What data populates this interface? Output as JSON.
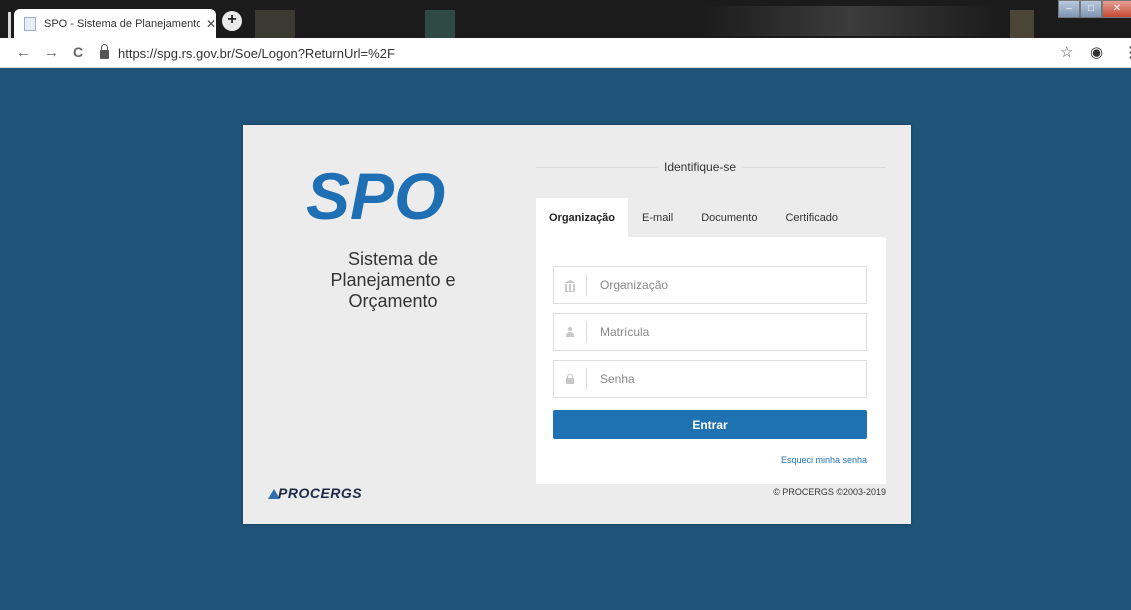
{
  "browser": {
    "tab_title": "SPO - Sistema de Planejamento e",
    "tab_close": "✕",
    "new_tab": "+",
    "back": "←",
    "forward": "→",
    "reload": "C",
    "url": "https://spg.rs.gov.br/Soe/Logon?ReturnUrl=%2F",
    "star": "☆",
    "profile": "◉",
    "menu": "⋮",
    "window_minimize": "–",
    "window_maximize": "□",
    "window_close": "✕"
  },
  "brand": {
    "logo_text": "SPO",
    "logo_color": "#1f6fb5",
    "system_name_lines": [
      "Sistema de",
      "Planejamento e",
      "Orçamento"
    ],
    "company": "PROCERGS",
    "copyright": "© PROCERGS ©2003-2019"
  },
  "login": {
    "heading": "Identifique-se",
    "tabs": [
      {
        "label": "Organização",
        "active": true
      },
      {
        "label": "E-mail",
        "active": false
      },
      {
        "label": "Documento",
        "active": false
      },
      {
        "label": "Certificado",
        "active": false
      }
    ],
    "fields": [
      {
        "name": "organizacao",
        "icon": "bank-icon",
        "value": "",
        "placeholder": "Organização"
      },
      {
        "name": "matricula",
        "icon": "user-icon",
        "value": "",
        "placeholder": "Matrícula"
      },
      {
        "name": "senha",
        "icon": "lock-icon",
        "value": "",
        "placeholder": "Senha"
      }
    ],
    "submit_label": "Entrar",
    "forgot_label": "Esqueci minha senha",
    "accent_color": "#1f72b2"
  },
  "colors": {
    "page_background": "#1f5377",
    "card_background": "#ececec"
  }
}
